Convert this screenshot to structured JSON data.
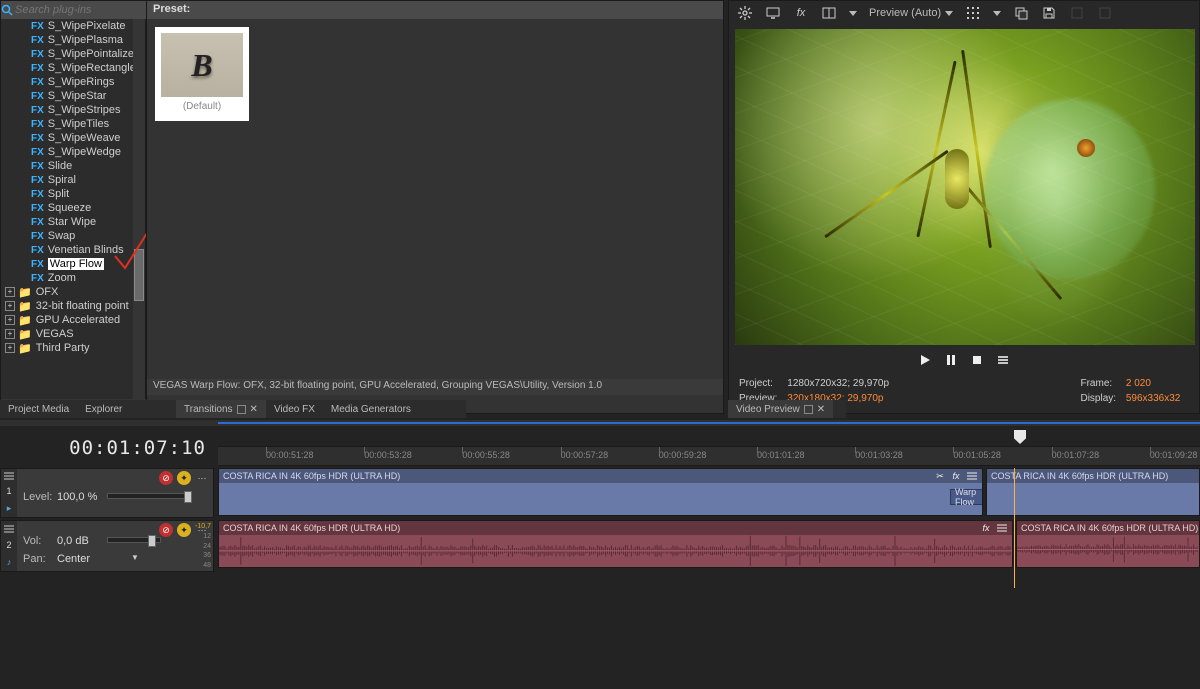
{
  "search": {
    "placeholder": "Search plug-ins"
  },
  "fxList": [
    "S_WipePixelate",
    "S_WipePlasma",
    "S_WipePointalize",
    "S_WipeRectangle",
    "S_WipeRings",
    "S_WipeStar",
    "S_WipeStripes",
    "S_WipeTiles",
    "S_WipeWeave",
    "S_WipeWedge",
    "Slide",
    "Spiral",
    "Split",
    "Squeeze",
    "Star Wipe",
    "Swap",
    "Venetian Blinds",
    "Warp Flow",
    "Zoom"
  ],
  "fxSelected": "Warp Flow",
  "folders": [
    "OFX",
    "32-bit floating point",
    "GPU Accelerated",
    "VEGAS",
    "Third Party"
  ],
  "preset": {
    "header": "Preset:",
    "defaultLabel": "(Default)",
    "glyph": "B"
  },
  "statusLine": "VEGAS Warp Flow: OFX, 32-bit floating point, GPU Accelerated, Grouping VEGAS\\Utility, Version 1.0",
  "tabsLeft": [
    "Project Media",
    "Explorer"
  ],
  "tabsRight": [
    "Transitions",
    "Video FX",
    "Media Generators"
  ],
  "tabsRightActive": "Transitions",
  "videoPreviewTab": "Video Preview",
  "preview": {
    "mode": "Preview (Auto)",
    "projectLabel": "Project:",
    "projectValue": "1280x720x32; 29,970p",
    "previewLabel": "Preview:",
    "previewValue": "320x180x32; 29,970p",
    "frameLabel": "Frame:",
    "frameValue": "2 020",
    "displayLabel": "Display:",
    "displayValue": "596x336x32"
  },
  "timecode": "00:01:07:10",
  "rulerLabels": [
    "00:00:51:28",
    "00:00:53:28",
    "00:00:55:28",
    "00:00:57:28",
    "00:00:59:28",
    "00:01:01:28",
    "00:01:03:28",
    "00:01:05:28",
    "00:01:07:28",
    "00:01:09:28"
  ],
  "videoTrack": {
    "levelLabel": "Level:",
    "levelValue": "100,0 %"
  },
  "audioTrack": {
    "volLabel": "Vol:",
    "volValue": "0,0 dB",
    "panLabel": "Pan:",
    "panValue": "Center",
    "topDb": "-10,7",
    "scale": [
      "12",
      "24",
      "36",
      "48"
    ]
  },
  "clipName": "COSTA RICA IN 4K 60fps HDR (ULTRA HD)",
  "transitionTag": "Warp Flow"
}
